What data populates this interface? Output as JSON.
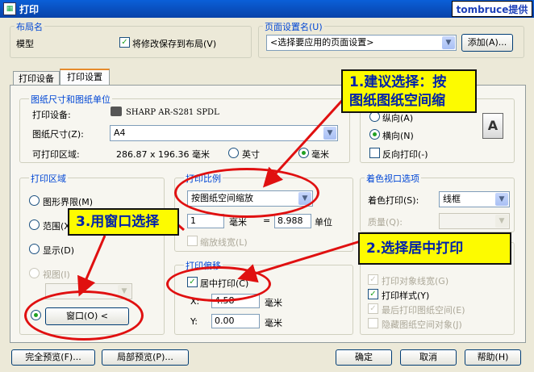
{
  "window": {
    "title": "打印",
    "brand": "tombruce提供"
  },
  "layout_group": {
    "label": "布局名",
    "name": "模型",
    "save_label": "将修改保存到布局(V)",
    "save_checked": true
  },
  "page_setup": {
    "label": "页面设置名(U)",
    "value": "<选择要应用的页面设置>",
    "add_button": "添加(A)..."
  },
  "tabs": [
    "打印设备",
    "打印设置"
  ],
  "paper": {
    "group_label": "图纸尺寸和图纸单位",
    "device_label": "打印设备:",
    "device_value": "SHARP AR-S281 SPDL",
    "size_label": "图纸尺寸(Z):",
    "size_value": "A4",
    "printable_label": "可打印区域:",
    "printable_value": "286.87 x 196.36 毫米",
    "unit_inch": "英寸",
    "unit_mm": "毫米"
  },
  "orientation": {
    "portrait": "纵向(A)",
    "landscape": "横向(N)",
    "reverse": "反向打印(-)",
    "icon_letter": "A"
  },
  "print_area": {
    "group_label": "打印区域",
    "limits": "图形界限(M)",
    "extents": "范围(X)",
    "display": "显示(D)",
    "view": "视图(I)",
    "window_button": "窗口(O) <"
  },
  "scale": {
    "group_label": "打印比例",
    "value": "按图纸空间缩放",
    "left": "1",
    "unit1": "毫米",
    "equals": "=",
    "right": "8.988",
    "unit2": "单位",
    "scale_lineweights": "缩放线宽(L)"
  },
  "offset": {
    "group_label": "打印偏移",
    "center": "居中打印(C)",
    "x_label": "X:",
    "x_value": "4.58",
    "x_unit": "毫米",
    "y_label": "Y:",
    "y_value": "0.00",
    "y_unit": "毫米"
  },
  "shade": {
    "group_label": "着色视口选项",
    "shade_label": "着色打印(S):",
    "shade_value": "线框",
    "quality_label": "质量(Q):"
  },
  "options": {
    "lineweights": "打印对象线宽(G)",
    "plotstyles": "打印样式(Y)",
    "paperspace_last": "最后打印图纸空间(E)",
    "hide_objects": "隐藏图纸空间对象(J)"
  },
  "footer": {
    "full_preview": "完全预览(F)...",
    "partial_preview": "局部预览(P)...",
    "ok": "确定",
    "cancel": "取消",
    "help": "帮助(H)"
  },
  "annotations": {
    "callout1_line1": "1.建议选择：按",
    "callout1_line2": "图纸图纸空间缩",
    "callout2": "2.选择居中打印",
    "callout3": "3.用窗口选择"
  },
  "colors": {
    "title_blue": "#0842a8",
    "group_label": "#0046d5",
    "callout_fill": "#fdfb00",
    "callout_text": "#0022aa",
    "highlight_red": "#e01010"
  }
}
